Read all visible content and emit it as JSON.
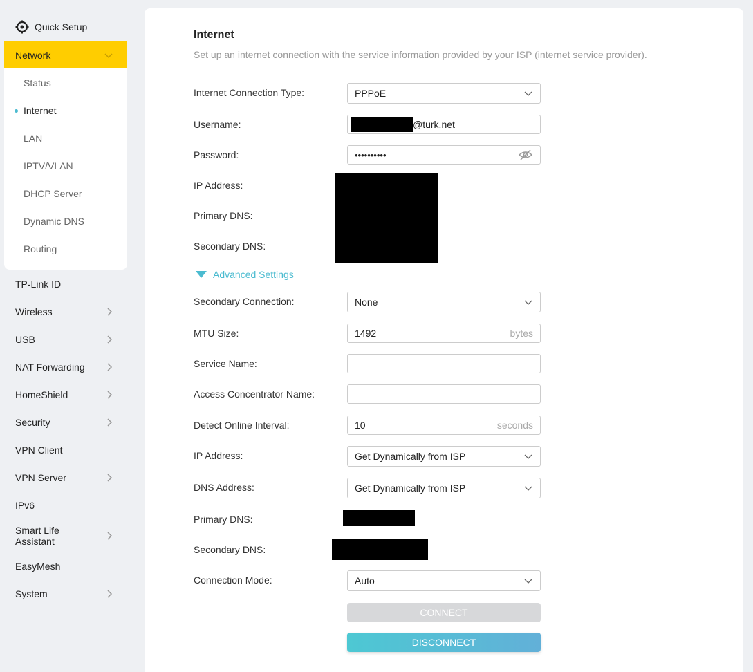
{
  "sidebar": {
    "quick_setup": "Quick Setup",
    "network": {
      "label": "Network",
      "items": [
        {
          "label": "Status"
        },
        {
          "label": "Internet",
          "active": true
        },
        {
          "label": "LAN"
        },
        {
          "label": "IPTV/VLAN"
        },
        {
          "label": "DHCP Server"
        },
        {
          "label": "Dynamic DNS"
        },
        {
          "label": "Routing"
        }
      ]
    },
    "items": [
      {
        "label": "TP-Link ID"
      },
      {
        "label": "Wireless"
      },
      {
        "label": "USB"
      },
      {
        "label": "NAT Forwarding"
      },
      {
        "label": "HomeShield"
      },
      {
        "label": "Security"
      },
      {
        "label": "VPN Client"
      },
      {
        "label": "VPN Server"
      },
      {
        "label": "IPv6"
      },
      {
        "label": "Smart Life\nAssistant"
      },
      {
        "label": "EasyMesh"
      },
      {
        "label": "System"
      }
    ]
  },
  "main": {
    "title": "Internet",
    "subtitle": "Set up an internet connection with the service information provided by your ISP (internet service provider).",
    "connection_type_label": "Internet Connection Type:",
    "connection_type_value": "PPPoE",
    "username_label": "Username:",
    "username_suffix": "@turk.net",
    "password_label": "Password:",
    "password_value": "••••••••••",
    "ip_address_label": "IP Address:",
    "primary_dns_label": "Primary DNS:",
    "secondary_dns_label": "Secondary DNS:",
    "advanced_settings": "Advanced Settings",
    "secondary_connection_label": "Secondary Connection:",
    "secondary_connection_value": "None",
    "mtu_label": "MTU Size:",
    "mtu_value": "1492",
    "mtu_unit": "bytes",
    "service_name_label": "Service Name:",
    "service_name_value": "",
    "ac_name_label": "Access Concentrator Name:",
    "ac_name_value": "",
    "detect_label": "Detect Online Interval:",
    "detect_value": "10",
    "detect_unit": "seconds",
    "adv_ip_label": "IP Address:",
    "adv_ip_value": "Get Dynamically from ISP",
    "dns_address_label": "DNS Address:",
    "dns_address_value": "Get Dynamically from ISP",
    "adv_primary_dns_label": "Primary DNS:",
    "adv_secondary_dns_label": "Secondary DNS:",
    "connection_mode_label": "Connection Mode:",
    "connection_mode_value": "Auto",
    "connect_button": "CONNECT",
    "disconnect_button": "DISCONNECT"
  },
  "colors": {
    "accent_yellow": "#ffcd00",
    "accent_teal": "#4bbbd0",
    "disabled_gray": "#d7d8da"
  }
}
